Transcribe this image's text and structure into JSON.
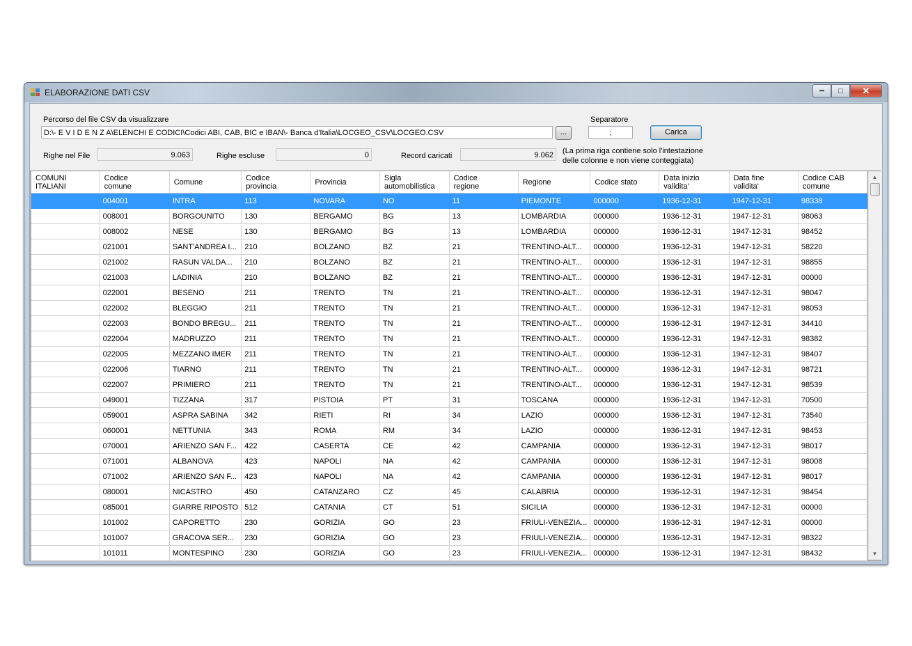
{
  "window": {
    "title": "ELABORAZIONE DATI CSV"
  },
  "form": {
    "path_label": "Percorso del file CSV da visualizzare",
    "path_value": "D:\\- E V I D E N Z A\\ELENCHI E CODICI\\Codici ABI, CAB, BIC e IBAN\\- Banca d'Italia\\LOCGEO_CSV\\LOCGEO.CSV",
    "browse_label": "...",
    "separator_label": "Separatore",
    "separator_value": ";",
    "load_label": "Carica",
    "rows_in_file_label": "Righe nel File",
    "rows_in_file_value": "9.063",
    "excluded_rows_label": "Righe escluse",
    "excluded_rows_value": "0",
    "loaded_records_label": "Record caricati",
    "loaded_records_value": "9.062",
    "note_line1": "(La prima riga contiene solo l'intestazione",
    "note_line2": "delle colonne e non viene conteggiata)"
  },
  "grid": {
    "corner_header_line1": "COMUNI",
    "corner_header_line2": "ITALIANI",
    "columns": [
      [
        "Codice",
        "comune"
      ],
      [
        "Comune",
        ""
      ],
      [
        "Codice",
        "provincia"
      ],
      [
        "Provincia",
        ""
      ],
      [
        "Sigla",
        "automobilistica"
      ],
      [
        "Codice",
        "regione"
      ],
      [
        "Regione",
        ""
      ],
      [
        "Codice stato",
        ""
      ],
      [
        "Data inizio",
        "validita'"
      ],
      [
        "Data fine",
        "validita'"
      ],
      [
        "Codice CAB",
        "comune"
      ]
    ],
    "selected_row": 0,
    "rows": [
      [
        "004001",
        "INTRA",
        "113",
        "NOVARA",
        "NO",
        "11",
        "PIEMONTE",
        "000000",
        "1936-12-31",
        "1947-12-31",
        "98338"
      ],
      [
        "008001",
        "BORGOUNITO",
        "130",
        "BERGAMO",
        "BG",
        "13",
        "LOMBARDIA",
        "000000",
        "1936-12-31",
        "1947-12-31",
        "98063"
      ],
      [
        "008002",
        "NESE",
        "130",
        "BERGAMO",
        "BG",
        "13",
        "LOMBARDIA",
        "000000",
        "1936-12-31",
        "1947-12-31",
        "98452"
      ],
      [
        "021001",
        "SANT'ANDREA I...",
        "210",
        "BOLZANO",
        "BZ",
        "21",
        "TRENTINO-ALT...",
        "000000",
        "1936-12-31",
        "1947-12-31",
        "58220"
      ],
      [
        "021002",
        "RASUN VALDA...",
        "210",
        "BOLZANO",
        "BZ",
        "21",
        "TRENTINO-ALT...",
        "000000",
        "1936-12-31",
        "1947-12-31",
        "98855"
      ],
      [
        "021003",
        "LADINIA",
        "210",
        "BOLZANO",
        "BZ",
        "21",
        "TRENTINO-ALT...",
        "000000",
        "1936-12-31",
        "1947-12-31",
        "00000"
      ],
      [
        "022001",
        "BESENO",
        "211",
        "TRENTO",
        "TN",
        "21",
        "TRENTINO-ALT...",
        "000000",
        "1936-12-31",
        "1947-12-31",
        "98047"
      ],
      [
        "022002",
        "BLEGGIO",
        "211",
        "TRENTO",
        "TN",
        "21",
        "TRENTINO-ALT...",
        "000000",
        "1936-12-31",
        "1947-12-31",
        "98053"
      ],
      [
        "022003",
        "BONDO BREGU...",
        "211",
        "TRENTO",
        "TN",
        "21",
        "TRENTINO-ALT...",
        "000000",
        "1936-12-31",
        "1947-12-31",
        "34410"
      ],
      [
        "022004",
        "MADRUZZO",
        "211",
        "TRENTO",
        "TN",
        "21",
        "TRENTINO-ALT...",
        "000000",
        "1936-12-31",
        "1947-12-31",
        "98382"
      ],
      [
        "022005",
        "MEZZANO IMER",
        "211",
        "TRENTO",
        "TN",
        "21",
        "TRENTINO-ALT...",
        "000000",
        "1936-12-31",
        "1947-12-31",
        "98407"
      ],
      [
        "022006",
        "TIARNO",
        "211",
        "TRENTO",
        "TN",
        "21",
        "TRENTINO-ALT...",
        "000000",
        "1936-12-31",
        "1947-12-31",
        "98721"
      ],
      [
        "022007",
        "PRIMIERO",
        "211",
        "TRENTO",
        "TN",
        "21",
        "TRENTINO-ALT...",
        "000000",
        "1936-12-31",
        "1947-12-31",
        "98539"
      ],
      [
        "049001",
        "TIZZANA",
        "317",
        "PISTOIA",
        "PT",
        "31",
        "TOSCANA",
        "000000",
        "1936-12-31",
        "1947-12-31",
        "70500"
      ],
      [
        "059001",
        "ASPRA SABINA",
        "342",
        "RIETI",
        "RI",
        "34",
        "LAZIO",
        "000000",
        "1936-12-31",
        "1947-12-31",
        "73540"
      ],
      [
        "060001",
        "NETTUNIA",
        "343",
        "ROMA",
        "RM",
        "34",
        "LAZIO",
        "000000",
        "1936-12-31",
        "1947-12-31",
        "98453"
      ],
      [
        "070001",
        "ARIENZO SAN F...",
        "422",
        "CASERTA",
        "CE",
        "42",
        "CAMPANIA",
        "000000",
        "1936-12-31",
        "1947-12-31",
        "98017"
      ],
      [
        "071001",
        "ALBANOVA",
        "423",
        "NAPOLI",
        "NA",
        "42",
        "CAMPANIA",
        "000000",
        "1936-12-31",
        "1947-12-31",
        "98008"
      ],
      [
        "071002",
        "ARIENZO SAN F...",
        "423",
        "NAPOLI",
        "NA",
        "42",
        "CAMPANIA",
        "000000",
        "1936-12-31",
        "1947-12-31",
        "98017"
      ],
      [
        "080001",
        "NICASTRO",
        "450",
        "CATANZARO",
        "CZ",
        "45",
        "CALABRIA",
        "000000",
        "1936-12-31",
        "1947-12-31",
        "98454"
      ],
      [
        "085001",
        "GIARRE RIPOSTO",
        "512",
        "CATANIA",
        "CT",
        "51",
        "SICILIA",
        "000000",
        "1936-12-31",
        "1947-12-31",
        "00000"
      ],
      [
        "101002",
        "CAPORETTO",
        "230",
        "GORIZIA",
        "GO",
        "23",
        "FRIULI-VENEZIA...",
        "000000",
        "1936-12-31",
        "1947-12-31",
        "00000"
      ],
      [
        "101007",
        "GRACOVA SER...",
        "230",
        "GORIZIA",
        "GO",
        "23",
        "FRIULI-VENEZIA...",
        "000000",
        "1936-12-31",
        "1947-12-31",
        "98322"
      ],
      [
        "101011",
        "MONTESPINO",
        "230",
        "GORIZIA",
        "GO",
        "23",
        "FRIULI-VENEZIA...",
        "000000",
        "1936-12-31",
        "1947-12-31",
        "98432"
      ]
    ]
  },
  "colors": {
    "selection": "#3399ff",
    "close_button": "#c7412b"
  }
}
